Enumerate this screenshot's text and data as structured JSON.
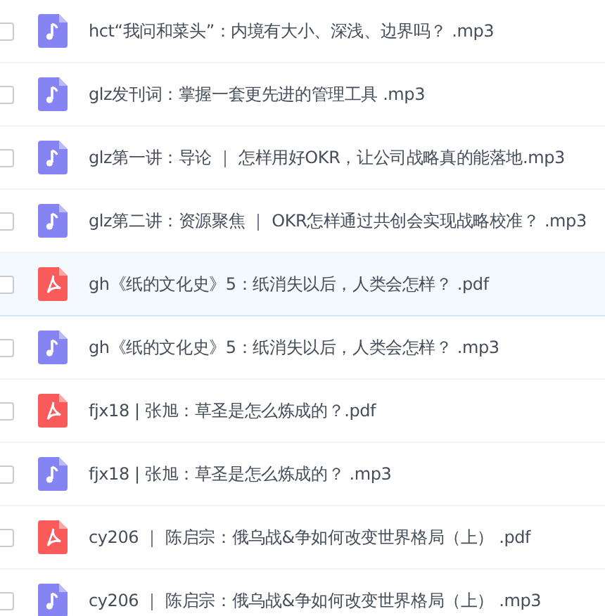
{
  "files": [
    {
      "name": "hct“我问和菜头”：内境有大小、深浅、边界吗？ .mp3",
      "kind": "audio",
      "checked": false,
      "highlighted": false
    },
    {
      "name": "glz发刊词：掌握一套更先进的管理工具 .mp3",
      "kind": "audio",
      "checked": false,
      "highlighted": false
    },
    {
      "name": "glz第一讲：导论 ｜ 怎样用好OKR，让公司战略真的能落地.mp3",
      "kind": "audio",
      "checked": false,
      "highlighted": false
    },
    {
      "name": "glz第二讲：资源聚焦 ｜ OKR怎样通过共创会实现战略校准？ .mp3",
      "kind": "audio",
      "checked": false,
      "highlighted": false
    },
    {
      "name": "gh《纸的文化史》5：纸消失以后，人类会怎样？ .pdf",
      "kind": "pdf",
      "checked": false,
      "highlighted": true
    },
    {
      "name": "gh《纸的文化史》5：纸消失以后，人类会怎样？ .mp3",
      "kind": "audio",
      "checked": false,
      "highlighted": false
    },
    {
      "name": "fjx18 | 张旭：草圣是怎么炼成的？.pdf",
      "kind": "pdf",
      "checked": false,
      "highlighted": false
    },
    {
      "name": "fjx18 | 张旭：草圣是怎么炼成的？ .mp3",
      "kind": "audio",
      "checked": false,
      "highlighted": false
    },
    {
      "name": "cy206 ｜ 陈启宗：俄乌战&争如何改变世界格局（上） .pdf",
      "kind": "pdf",
      "checked": false,
      "highlighted": false
    },
    {
      "name": "cy206 ｜ 陈启宗：俄乌战&争如何改变世界格局（上） .mp3",
      "kind": "audio",
      "checked": false,
      "highlighted": false
    }
  ]
}
